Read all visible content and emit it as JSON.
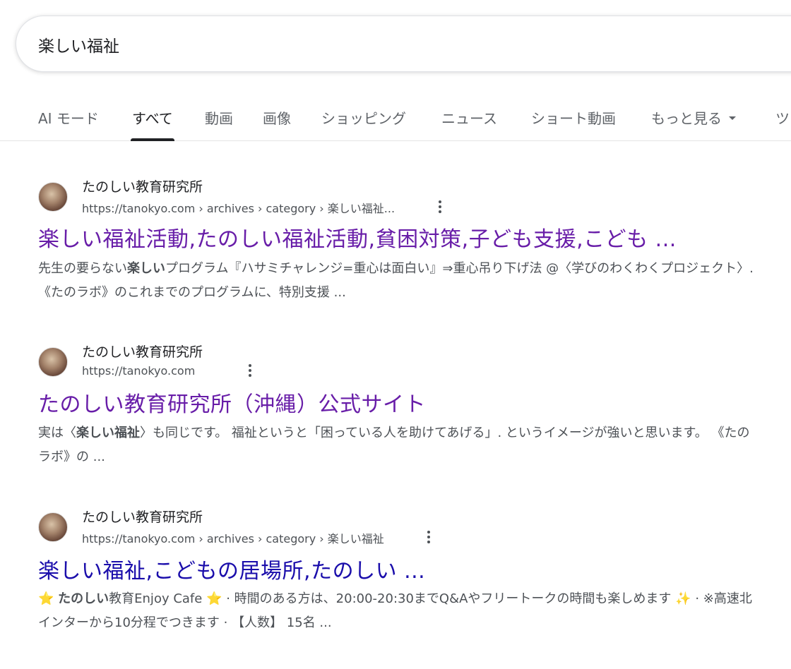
{
  "search": {
    "query": "楽しい福祉"
  },
  "tabs": [
    {
      "label": "AI モード"
    },
    {
      "label": "すべて"
    },
    {
      "label": "動画"
    },
    {
      "label": "画像"
    },
    {
      "label": "ショッピング"
    },
    {
      "label": "ニュース"
    },
    {
      "label": "ショート動画"
    },
    {
      "label": "もっと見る"
    },
    {
      "label": "ツ"
    }
  ],
  "results": [
    {
      "site_name": "たのしい教育研究所",
      "url": "https://tanokyo.com › archives › category › 楽しい福祉...",
      "title": "楽しい福祉活動,たのしい福祉活動,貧困対策,子ども支援,こども ...",
      "snippet": {
        "p1": "先生の要らない",
        "b1": "楽しい",
        "p2": "プログラム『ハサミチャレンジ=重心は面白い』⇒重心吊り下げ法 @〈学びのわくわくプロジェクト〉. 《たのラボ》のこれまでのプログラムに、特別支援 ..."
      }
    },
    {
      "site_name": "たのしい教育研究所",
      "url": "https://tanokyo.com",
      "title": "たのしい教育研究所（沖縄）公式サイト",
      "snippet": {
        "p1": "実は〈",
        "b1": "楽しい福祉",
        "p2": "〉も同じです。 福祉というと「困っている人を助けてあげる」. というイメージが強いと思います。 《たのラボ》の ..."
      }
    },
    {
      "site_name": "たのしい教育研究所",
      "url": "https://tanokyo.com › archives › category › 楽しい福祉",
      "title": "楽しい福祉,こどもの居場所,たのしい ...",
      "snippet": {
        "star1": "⭐",
        "b1": "たのしい",
        "p1": "教育Enjoy Cafe",
        "star2": "⭐",
        "p2": "· 時間のある方は、20:00-20:30までQ&Aやフリートークの時間も楽しめます",
        "sparkle": "✨",
        "p3": "· ※高速北インターから10分程でつきます · 【人数】 15名 ..."
      }
    }
  ]
}
